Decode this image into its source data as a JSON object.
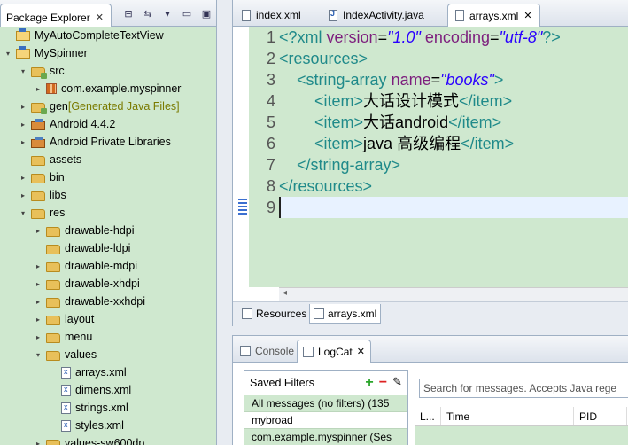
{
  "package_explorer": {
    "title": "Package Explorer",
    "close": "✕",
    "tree": [
      {
        "label": "MyAutoCompleteTextView",
        "indent": 0,
        "icon": "project",
        "arrow": ""
      },
      {
        "label": "MySpinner",
        "indent": 0,
        "icon": "project",
        "arrow": "▾"
      },
      {
        "label": "src",
        "indent": 1,
        "icon": "src-folder",
        "arrow": "▾"
      },
      {
        "label": "com.example.myspinner",
        "indent": 2,
        "icon": "package",
        "arrow": "▸"
      },
      {
        "label": "gen",
        "decor": "[Generated Java Files]",
        "indent": 1,
        "icon": "src-folder",
        "arrow": "▸"
      },
      {
        "label": "Android 4.4.2",
        "indent": 1,
        "icon": "library",
        "arrow": "▸"
      },
      {
        "label": "Android Private Libraries",
        "indent": 1,
        "icon": "library",
        "arrow": "▸"
      },
      {
        "label": "assets",
        "indent": 1,
        "icon": "folder",
        "arrow": ""
      },
      {
        "label": "bin",
        "indent": 1,
        "icon": "folder",
        "arrow": "▸"
      },
      {
        "label": "libs",
        "indent": 1,
        "icon": "folder",
        "arrow": "▸"
      },
      {
        "label": "res",
        "indent": 1,
        "icon": "folder",
        "arrow": "▾"
      },
      {
        "label": "drawable-hdpi",
        "indent": 2,
        "icon": "folder",
        "arrow": "▸"
      },
      {
        "label": "drawable-ldpi",
        "indent": 2,
        "icon": "folder",
        "arrow": ""
      },
      {
        "label": "drawable-mdpi",
        "indent": 2,
        "icon": "folder",
        "arrow": "▸"
      },
      {
        "label": "drawable-xhdpi",
        "indent": 2,
        "icon": "folder",
        "arrow": "▸"
      },
      {
        "label": "drawable-xxhdpi",
        "indent": 2,
        "icon": "folder",
        "arrow": "▸"
      },
      {
        "label": "layout",
        "indent": 2,
        "icon": "folder",
        "arrow": "▸"
      },
      {
        "label": "menu",
        "indent": 2,
        "icon": "folder",
        "arrow": "▸"
      },
      {
        "label": "values",
        "indent": 2,
        "icon": "folder",
        "arrow": "▾"
      },
      {
        "label": "arrays.xml",
        "indent": 3,
        "icon": "xml-file",
        "arrow": ""
      },
      {
        "label": "dimens.xml",
        "indent": 3,
        "icon": "xml-file",
        "arrow": ""
      },
      {
        "label": "strings.xml",
        "indent": 3,
        "icon": "xml-file",
        "arrow": ""
      },
      {
        "label": "styles.xml",
        "indent": 3,
        "icon": "xml-file",
        "arrow": ""
      },
      {
        "label": "values-sw600dp",
        "indent": 2,
        "icon": "folder",
        "arrow": "▸"
      }
    ]
  },
  "editor": {
    "tabs": [
      {
        "label": "index.xml",
        "active": false
      },
      {
        "label": "IndexActivity.java",
        "active": false
      },
      {
        "label": "arrays.xml",
        "active": true,
        "close": "✕"
      }
    ],
    "line_numbers": [
      "1",
      "2",
      "3",
      "4",
      "5",
      "6",
      "7",
      "8",
      "9"
    ],
    "code": [
      [
        {
          "c": "tag",
          "t": "<?xml "
        },
        {
          "c": "attr",
          "t": "version"
        },
        {
          "c": "txt",
          "t": "="
        },
        {
          "c": "val",
          "t": "\"1.0\""
        },
        {
          "c": "txt",
          "t": " "
        },
        {
          "c": "attr",
          "t": "encoding"
        },
        {
          "c": "txt",
          "t": "="
        },
        {
          "c": "val",
          "t": "\"utf-8\""
        },
        {
          "c": "tag",
          "t": "?>"
        }
      ],
      [
        {
          "c": "tag",
          "t": "<resources>"
        }
      ],
      [
        {
          "c": "txt",
          "t": "    "
        },
        {
          "c": "tag",
          "t": "<string-array "
        },
        {
          "c": "attr",
          "t": "name"
        },
        {
          "c": "txt",
          "t": "="
        },
        {
          "c": "val",
          "t": "\"books\""
        },
        {
          "c": "tag",
          "t": ">"
        }
      ],
      [
        {
          "c": "txt",
          "t": "        "
        },
        {
          "c": "tag",
          "t": "<item>"
        },
        {
          "c": "txt",
          "t": "大话设计模式"
        },
        {
          "c": "tag",
          "t": "</item>"
        }
      ],
      [
        {
          "c": "txt",
          "t": "        "
        },
        {
          "c": "tag",
          "t": "<item>"
        },
        {
          "c": "txt",
          "t": "大话android"
        },
        {
          "c": "tag",
          "t": "</item>"
        }
      ],
      [
        {
          "c": "txt",
          "t": "        "
        },
        {
          "c": "tag",
          "t": "<item>"
        },
        {
          "c": "txt",
          "t": "java 高级编程"
        },
        {
          "c": "tag",
          "t": "</item>"
        }
      ],
      [
        {
          "c": "txt",
          "t": "    "
        },
        {
          "c": "tag",
          "t": "</string-array>"
        }
      ],
      [
        {
          "c": "tag",
          "t": "</resources>"
        }
      ],
      []
    ],
    "hscroll_arrow": "◂",
    "bottom_tabs": [
      {
        "label": "Resources",
        "active": false
      },
      {
        "label": "arrays.xml",
        "active": true
      }
    ]
  },
  "console": {
    "tabs": [
      {
        "label": "Console",
        "active": false
      },
      {
        "label": "LogCat",
        "active": true,
        "close": "✕"
      }
    ],
    "saved_filters_title": "Saved Filters",
    "filter_rows": [
      "All messages (no filters) (135",
      "mybroad",
      "com.example.myspinner (Ses"
    ],
    "search_placeholder": "Search for messages. Accepts Java rege",
    "columns": [
      "L...",
      "Time",
      "PID"
    ]
  }
}
